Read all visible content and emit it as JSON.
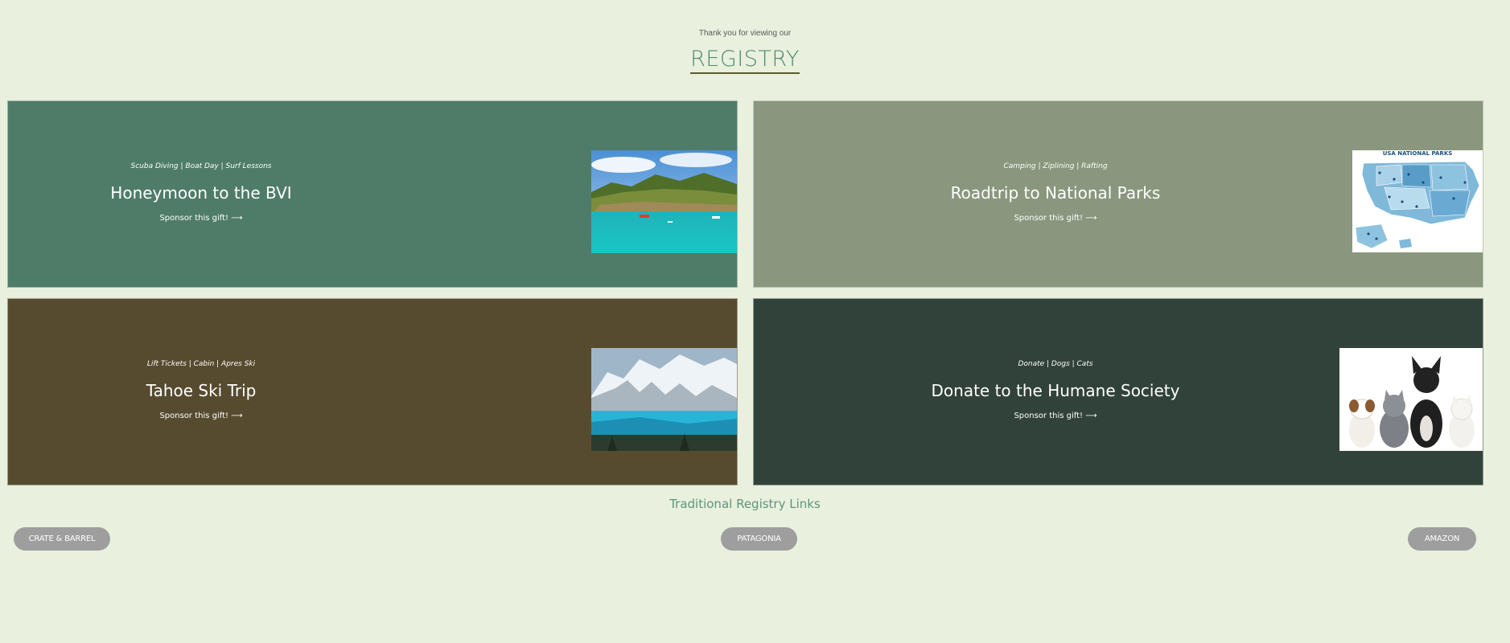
{
  "header": {
    "intro": "Thank you for viewing our",
    "title": "REGISTRY"
  },
  "cards": [
    {
      "tags": "Scuba Diving | Boat Day | Surf Lessons",
      "title": "Honeymoon to the BVI",
      "cta": "Sponsor this gift! ⟶",
      "bg": "#4f7c69",
      "image": "tropical-island-photo"
    },
    {
      "tags": "Camping | Ziplining | Rafting",
      "title": "Roadtrip to National Parks",
      "cta": "Sponsor this gift! ⟶",
      "bg": "#8a977e",
      "image": "usa-national-parks-map",
      "map_title": "USA NATIONAL PARKS"
    },
    {
      "tags": "Lift Tickets | Cabin | Apres Ski",
      "title": "Tahoe Ski Trip",
      "cta": "Sponsor this gift! ⟶",
      "bg": "#574b2f",
      "image": "snowy-mountain-lake-photo"
    },
    {
      "tags": "Donate | Dogs | Cats",
      "title": "Donate to the Humane Society",
      "cta": "Sponsor this gift! ⟶",
      "bg": "#31423a",
      "image": "dogs-and-cats-photo"
    }
  ],
  "traditional": {
    "title": "Traditional Registry Links",
    "links": [
      "CRATE & BARREL",
      "PATAGONIA",
      "AMAZON"
    ]
  },
  "colors": {
    "page_bg": "#e9f0de",
    "accent": "#4f8a6c",
    "pill": "#9e9e9e"
  }
}
